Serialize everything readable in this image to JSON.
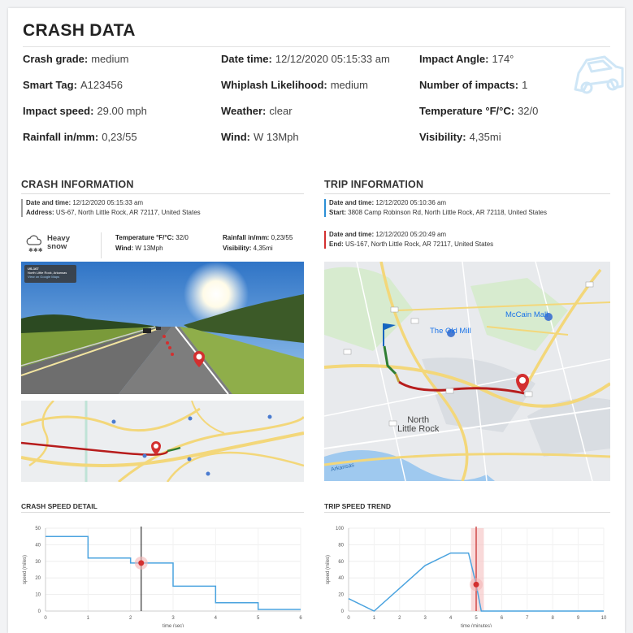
{
  "header": {
    "title": "CRASH DATA"
  },
  "summary": [
    {
      "label": "Crash grade:",
      "value": "medium"
    },
    {
      "label": "Date time:",
      "value": "12/12/2020 05:15:33 am"
    },
    {
      "label": "Impact Angle:",
      "value": "174°"
    },
    {
      "label": "Smart Tag:",
      "value": "A123456"
    },
    {
      "label": "Whiplash Likelihood:",
      "value": "medium"
    },
    {
      "label": "Number of impacts:",
      "value": "1"
    },
    {
      "label": "Impact speed:",
      "value": "29.00 mph"
    },
    {
      "label": "Weather:",
      "value": "clear"
    },
    {
      "label": "Temperature °F/°C:",
      "value": "32/0"
    },
    {
      "label": "Rainfall in/mm:",
      "value": "0,23/55"
    },
    {
      "label": "Wind:",
      "value": "W 13Mph"
    },
    {
      "label": "Visibility:",
      "value": "4,35mi"
    }
  ],
  "crash_info": {
    "title": "CRASH INFORMATION",
    "datetime_label": "Date and time:",
    "datetime_value": "12/12/2020 05:15:33 am",
    "address_label": "Address:",
    "address_value": "US-67, North Little Rock, AR 72117, United States",
    "weather": {
      "condition_line1": "Heavy",
      "condition_line2": "snow",
      "temp_label": "Temperature °F/°C:",
      "temp_value": "32/0",
      "wind_label": "Wind:",
      "wind_value": "W 13Mph",
      "rain_label": "Rainfall in/mm:",
      "rain_value": "0,23/55",
      "vis_label": "Visibility:",
      "vis_value": "4,35mi"
    },
    "streetview_chip_line1": "US-167",
    "streetview_chip_line2": "North Little Rock, Arkansas",
    "streetview_chip_line3": "View on Google Maps"
  },
  "trip_info": {
    "title": "TRIP INFORMATION",
    "start_datetime_label": "Date and time:",
    "start_datetime_value": "12/12/2020 05:10:36 am",
    "start_label": "Start:",
    "start_value": "3808 Camp Robinson Rd, North Little Rock, AR 72118, United States",
    "end_datetime_label": "Date and time:",
    "end_datetime_value": "12/12/2020 05:20:49 am",
    "end_label": "End:",
    "end_value": "US-167, North Little Rock, AR 72117, United States",
    "map_labels": {
      "old_mill": "The Old Mill",
      "mccain": "McCain Mall",
      "city1": "North",
      "city2": "Little Rock",
      "river": "Arkansas"
    }
  },
  "colors": {
    "accent_blue": "#2b8fd6",
    "accent_red": "#d32f2f",
    "route_red": "#b71c1c",
    "line_blue": "#4aa3df"
  },
  "chart_data": [
    {
      "type": "line",
      "title": "CRASH SPEED DETAIL",
      "xlabel": "time (sec)",
      "ylabel": "speed (miles)",
      "xlim": [
        0,
        6
      ],
      "ylim": [
        0,
        50
      ],
      "xticks": [
        "0",
        "1",
        "2",
        "3",
        "4",
        "5",
        "6"
      ],
      "yticks": [
        "0",
        "10",
        "20",
        "30",
        "40",
        "50"
      ],
      "step": true,
      "x": [
        0,
        1,
        1,
        2,
        2,
        3,
        3,
        4,
        4,
        5,
        5,
        6
      ],
      "y": [
        45,
        45,
        32,
        32,
        29,
        29,
        15,
        15,
        5,
        5,
        1,
        1
      ],
      "marker": {
        "x": 2.25,
        "y": 29
      },
      "vline": 2.25
    },
    {
      "type": "line",
      "title": "TRIP SPEED TREND",
      "xlabel": "time (minutes)",
      "ylabel": "speed (miles)",
      "xlim": [
        0,
        10
      ],
      "ylim": [
        0,
        100
      ],
      "xticks": [
        "0",
        "1",
        "2",
        "3",
        "4",
        "5",
        "6",
        "7",
        "8",
        "9",
        "10"
      ],
      "yticks": [
        "0",
        "20",
        "40",
        "60",
        "80",
        "100"
      ],
      "step": false,
      "x": [
        0,
        1,
        3,
        4,
        4.7,
        5.0,
        5.2,
        10
      ],
      "y": [
        15,
        0,
        55,
        70,
        70,
        32,
        0,
        0
      ],
      "marker": {
        "x": 5.0,
        "y": 32
      },
      "vline": 5.0,
      "band": [
        4.8,
        5.3
      ]
    }
  ]
}
